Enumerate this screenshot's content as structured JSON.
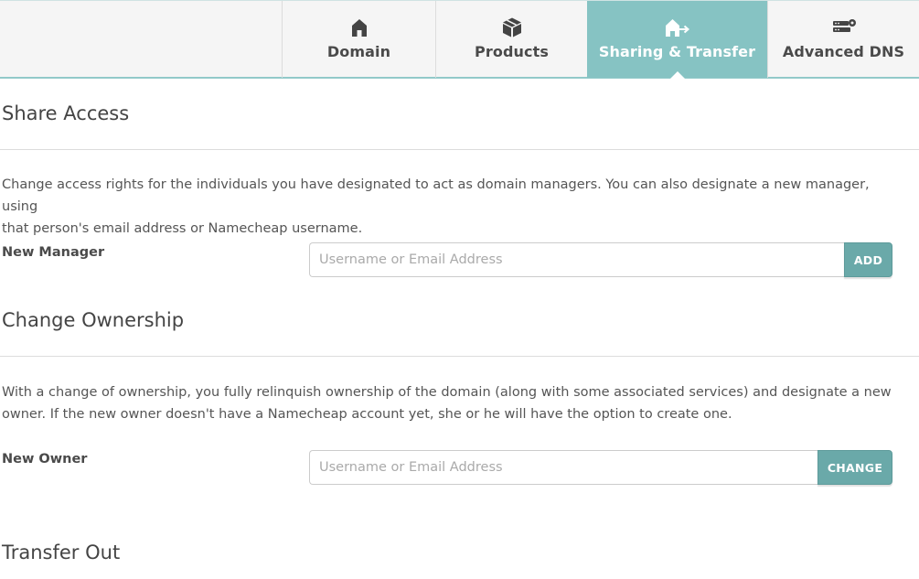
{
  "tabs": [
    {
      "label": "Domain",
      "icon": "house-icon"
    },
    {
      "label": "Products",
      "icon": "box-icon"
    },
    {
      "label": "Sharing & Transfer",
      "icon": "house-arrow-icon"
    },
    {
      "label": "Advanced DNS",
      "icon": "server-gear-icon"
    }
  ],
  "active_tab": "Sharing & Transfer",
  "share_access": {
    "heading": "Share Access",
    "description_line1": "Change access rights for the individuals you have designated to act as domain managers. You can also designate a new manager, using",
    "description_line2": "that person's email address or Namecheap username.",
    "field_label": "New Manager",
    "input_placeholder": "Username or Email Address",
    "button_label": "ADD"
  },
  "change_ownership": {
    "heading": "Change Ownership",
    "description_line1": "With a change of ownership, you fully relinquish ownership of the domain (along with some associated services) and designate a new",
    "description_line2": "owner. If the new owner doesn't have a Namecheap account yet, she or he will have the option to create one.",
    "field_label": "New Owner",
    "input_placeholder": "Username or Email Address",
    "button_label": "CHANGE"
  },
  "transfer_out": {
    "heading": "Transfer Out"
  },
  "colors": {
    "accent": "#86c3c3",
    "button": "#6aa9a9",
    "text": "#555555"
  }
}
